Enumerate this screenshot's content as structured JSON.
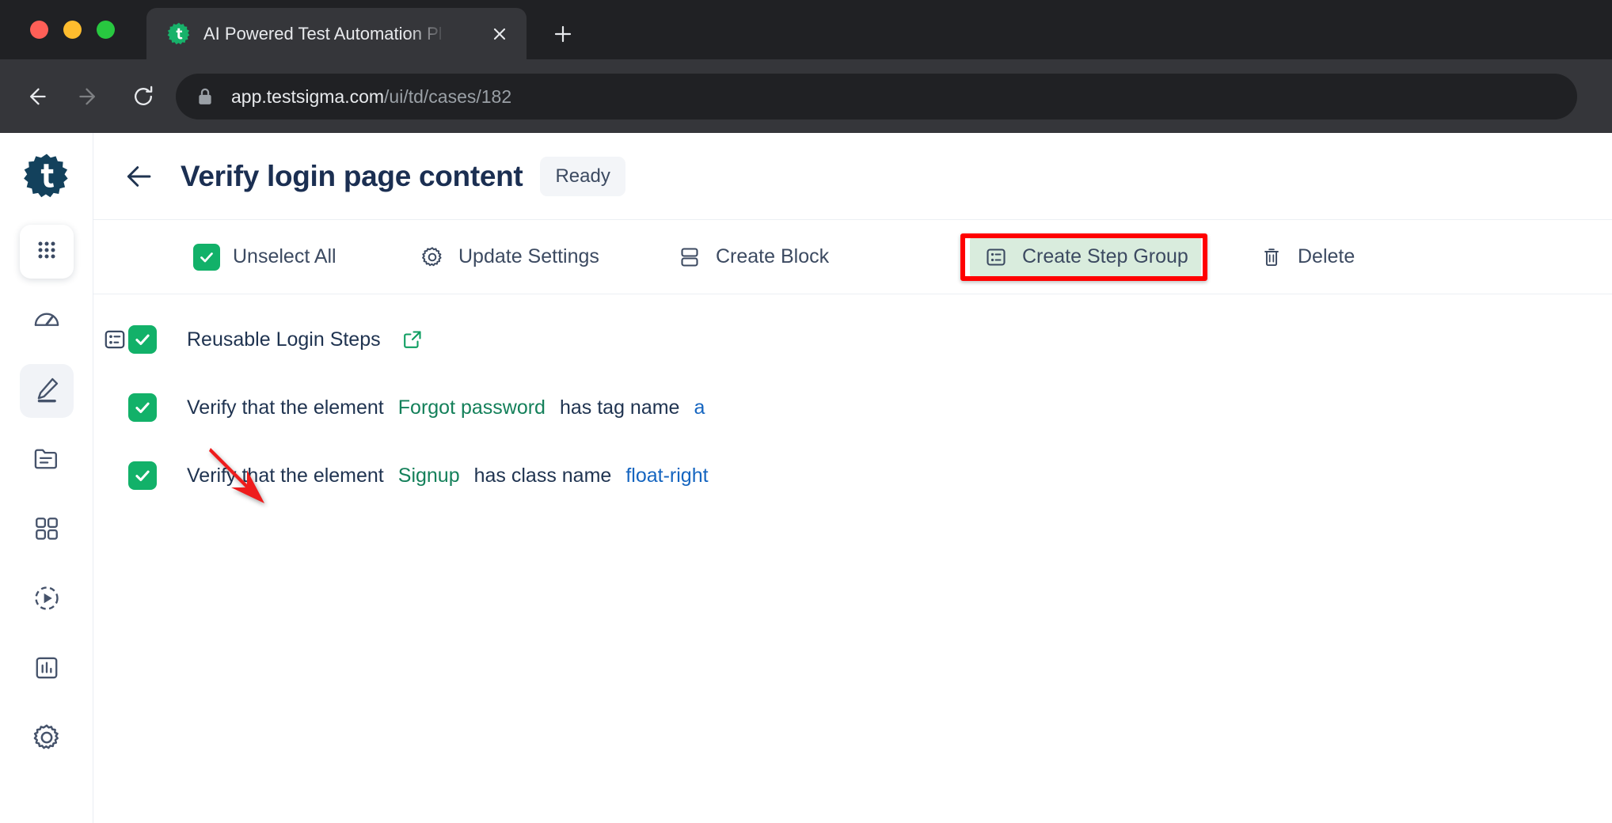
{
  "browser": {
    "tab": {
      "title": "AI Powered Test Automation Pl",
      "favicon_icon": "testsigma-gear-favicon",
      "close_icon": "close-icon"
    },
    "new_tab_icon": "plus-icon",
    "nav": {
      "back_icon": "arrow-left-icon",
      "forward_icon": "arrow-right-icon",
      "reload_icon": "reload-icon"
    },
    "omnibox": {
      "lock_icon": "lock-icon",
      "url_host": "app.testsigma.com",
      "url_path": "/ui/td/cases/182"
    }
  },
  "sidebar": {
    "logo_icon": "testsigma-logo-icon",
    "items": [
      {
        "name": "app-switcher",
        "icon": "grid-dots-icon",
        "active": false
      },
      {
        "name": "dashboard",
        "icon": "speedometer-icon",
        "active": false
      },
      {
        "name": "test-development",
        "icon": "pencil-icon",
        "active": true
      },
      {
        "name": "test-data",
        "icon": "folder-icon",
        "active": false
      },
      {
        "name": "test-plans",
        "icon": "squares-icon",
        "active": false
      },
      {
        "name": "runs",
        "icon": "play-circle-icon",
        "active": false
      },
      {
        "name": "reports",
        "icon": "bar-chart-icon",
        "active": false
      },
      {
        "name": "settings",
        "icon": "gear-icon",
        "active": false
      }
    ]
  },
  "header": {
    "back_icon": "arrow-left-icon",
    "title": "Verify login page content",
    "status": "Ready"
  },
  "action_bar": {
    "items": [
      {
        "label": "Unselect All",
        "icon": "checkbox-checked-icon",
        "highlighted": false
      },
      {
        "label": "Update Settings",
        "icon": "gear-icon",
        "highlighted": false
      },
      {
        "label": "Create Block",
        "icon": "stacked-rows-icon",
        "highlighted": false
      },
      {
        "label": "Create Step Group",
        "icon": "step-group-icon",
        "highlighted": true
      },
      {
        "label": "Delete",
        "icon": "trash-icon",
        "highlighted": false
      }
    ],
    "highlight_color": "#ff0000",
    "highlight_bg": "#d9ecdd"
  },
  "steps": [
    {
      "type": "step-group",
      "gutter_icon": "step-group-icon",
      "checked": true,
      "title": "Reusable Login Steps",
      "external_link_icon": "external-link-icon"
    },
    {
      "type": "verify",
      "checked": true,
      "prefix": "Verify that the element",
      "element": "Forgot password",
      "middle": "has tag name",
      "value": "a"
    },
    {
      "type": "verify",
      "checked": true,
      "prefix": "Verify that the element",
      "element": "Signup",
      "middle": "has class name",
      "value": "float-right"
    }
  ],
  "annotations": {
    "arrow_icon": "red-arrow-pointer",
    "arrow_color": "#ee1c1c"
  },
  "colors": {
    "green_check": "#12b169",
    "element_green": "#14805a",
    "value_blue": "#1565c0",
    "title_navy": "#1b2f52"
  }
}
